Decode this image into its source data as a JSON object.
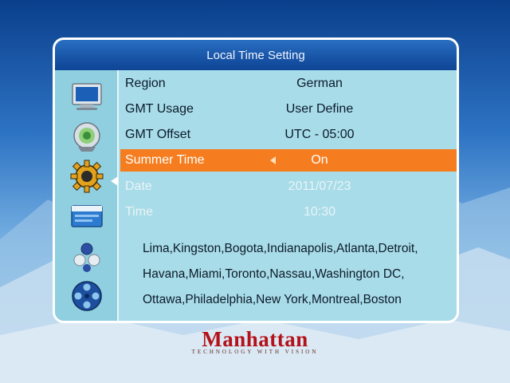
{
  "panel": {
    "title": "Local Time Setting"
  },
  "menu_icons": [
    "monitor-icon",
    "satellite-dish-icon",
    "gear-icon",
    "channel-list-icon",
    "game-pieces-icon",
    "film-reel-icon"
  ],
  "settings": [
    {
      "label": "Region",
      "value": "German",
      "state": "normal"
    },
    {
      "label": "GMT Usage",
      "value": "User Define",
      "state": "normal"
    },
    {
      "label": "GMT Offset",
      "value": "UTC - 05:00",
      "state": "normal"
    },
    {
      "label": "Summer Time",
      "value": "On",
      "state": "active"
    },
    {
      "label": "Date",
      "value": "2011/07/23",
      "state": "disabled"
    },
    {
      "label": "Time",
      "value": "10:30",
      "state": "disabled"
    }
  ],
  "cities": [
    "Lima,Kingston,Bogota,Indianapolis,Atlanta,Detroit,",
    "Havana,Miami,Toronto,Nassau,Washington DC,",
    "Ottawa,Philadelphia,New York,Montreal,Boston"
  ],
  "brand": {
    "name": "Manhattan",
    "tagline": "TECHNOLOGY WITH VISION"
  },
  "colors": {
    "highlight": "#f57d1f",
    "title_bar": "#1956a8",
    "panel_bg": "#a8dce8"
  }
}
